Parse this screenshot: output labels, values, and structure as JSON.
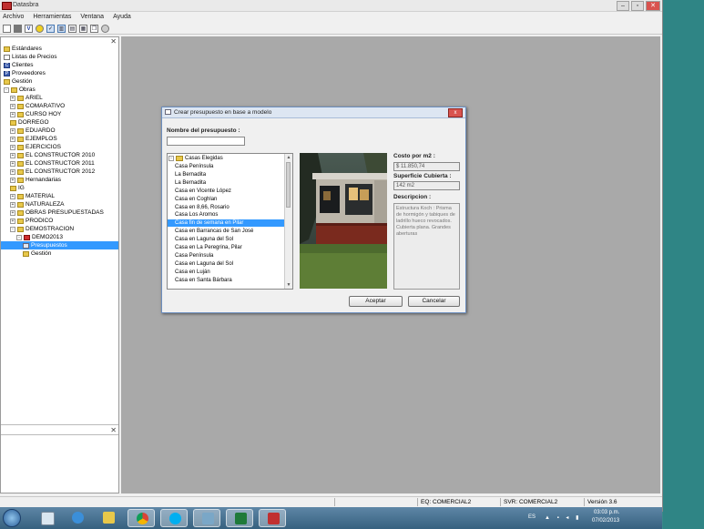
{
  "window": {
    "title": "Datasbra"
  },
  "menu": [
    "Archivo",
    "Herramientas",
    "Ventana",
    "Ayuda"
  ],
  "toolbar_icons": [
    "new-icon",
    "open-icon",
    "v-icon",
    "circle-icon",
    "check-icon",
    "grid-icon",
    "split-icon",
    "columns-icon",
    "copy-icon",
    "disc-icon"
  ],
  "tree": {
    "items": [
      {
        "label": "Estándares",
        "icon": "folder",
        "level": 0
      },
      {
        "label": "Listas de Precios",
        "icon": "doc",
        "level": 0
      },
      {
        "label": "Clientes",
        "icon": "blue",
        "letter": "C",
        "level": 0
      },
      {
        "label": "Proveedores",
        "icon": "blue",
        "letter": "P",
        "level": 0
      },
      {
        "label": "Gestión",
        "icon": "folder",
        "level": 0
      },
      {
        "label": "Obras",
        "icon": "folder",
        "level": 0,
        "exp": "-"
      },
      {
        "label": "ARIEL",
        "icon": "folder",
        "level": 1,
        "exp": "+"
      },
      {
        "label": "COMARATIVO",
        "icon": "folder",
        "level": 1,
        "exp": "+"
      },
      {
        "label": "CURSO HOY",
        "icon": "folder",
        "level": 1,
        "exp": "+"
      },
      {
        "label": "DORREGO",
        "icon": "folder",
        "level": 1
      },
      {
        "label": "EDUARDO",
        "icon": "folder",
        "level": 1,
        "exp": "+"
      },
      {
        "label": "EJEMPLOS",
        "icon": "folder",
        "level": 1,
        "exp": "+"
      },
      {
        "label": "EJERCICIOS",
        "icon": "folder",
        "level": 1,
        "exp": "+"
      },
      {
        "label": "EL CONSTRUCTOR 2010",
        "icon": "folder",
        "level": 1,
        "exp": "+"
      },
      {
        "label": "EL CONSTRUCTOR 2011",
        "icon": "folder",
        "level": 1,
        "exp": "+"
      },
      {
        "label": "EL CONSTRUCTOR 2012",
        "icon": "folder",
        "level": 1,
        "exp": "+"
      },
      {
        "label": "Hernandarias",
        "icon": "folder",
        "level": 1,
        "exp": "+"
      },
      {
        "label": "IG",
        "icon": "folder",
        "level": 1
      },
      {
        "label": "MATERIAL",
        "icon": "folder",
        "level": 1,
        "exp": "+"
      },
      {
        "label": "NATURALEZA",
        "icon": "folder",
        "level": 1,
        "exp": "+"
      },
      {
        "label": "OBRAS PRESUPUESTADAS",
        "icon": "folder",
        "level": 1,
        "exp": "+"
      },
      {
        "label": "PRODICO",
        "icon": "folder",
        "level": 1,
        "exp": "+"
      },
      {
        "label": "DEMOSTRACION",
        "icon": "folder",
        "level": 1,
        "exp": "-"
      },
      {
        "label": "DEMO2013",
        "icon": "red",
        "level": 2,
        "exp": "-"
      },
      {
        "label": "Presupuestos",
        "icon": "page",
        "level": 3,
        "selected": true
      },
      {
        "label": "Gestión",
        "icon": "folder",
        "level": 3
      }
    ]
  },
  "status": {
    "eq": "EQ: COMERCIAL2",
    "svr": "SVR: COMERCIAL2",
    "version": "Versión 3.6"
  },
  "dialog": {
    "title": "Crear presupuesto en base a modelo",
    "name_label": "Nombre del presupuesto :",
    "name_value": "",
    "list_root": "Casas Elegidas",
    "list_items": [
      "Casa Península",
      "La Bernadita",
      "La Bernadita",
      "Casa en Vicente López",
      "Casa en Coghlan",
      "Casa en 8,66, Rosario",
      "Casa Los Aromos",
      "Casa fin de semana en Pilar",
      "Casa en Barrancas de San José",
      "Casa en Laguna del Sol",
      "Casa en La Peregrina, Pilar",
      "Casa Península",
      "Casa en Laguna del Sol",
      "Casa en Luján",
      "Casa en Santa Bárbara"
    ],
    "selected_index": 7,
    "cost_label": "Costo por m2 :",
    "cost_value": "$ 11.850,74",
    "area_label": "Superficie Cubierta :",
    "area_value": "142 m2",
    "desc_label": "Descripcion :",
    "desc_value": "Estructura Koch : Prisma de hormigón y tabiques de ladrillo hueco revocados. Cubierta plana. Grandes aberturas",
    "accept_label": "Aceptar",
    "cancel_label": "Cancelar",
    "close_label": "x"
  },
  "taskbar": {
    "apps": [
      "explorer-icon",
      "ie-icon",
      "folder-icon",
      "chrome-icon",
      "skype-icon",
      "media-icon",
      "excel-icon",
      "datasbra-icon"
    ],
    "lang": "ES",
    "time": "03:03 p.m.",
    "date": "07/02/2013"
  }
}
